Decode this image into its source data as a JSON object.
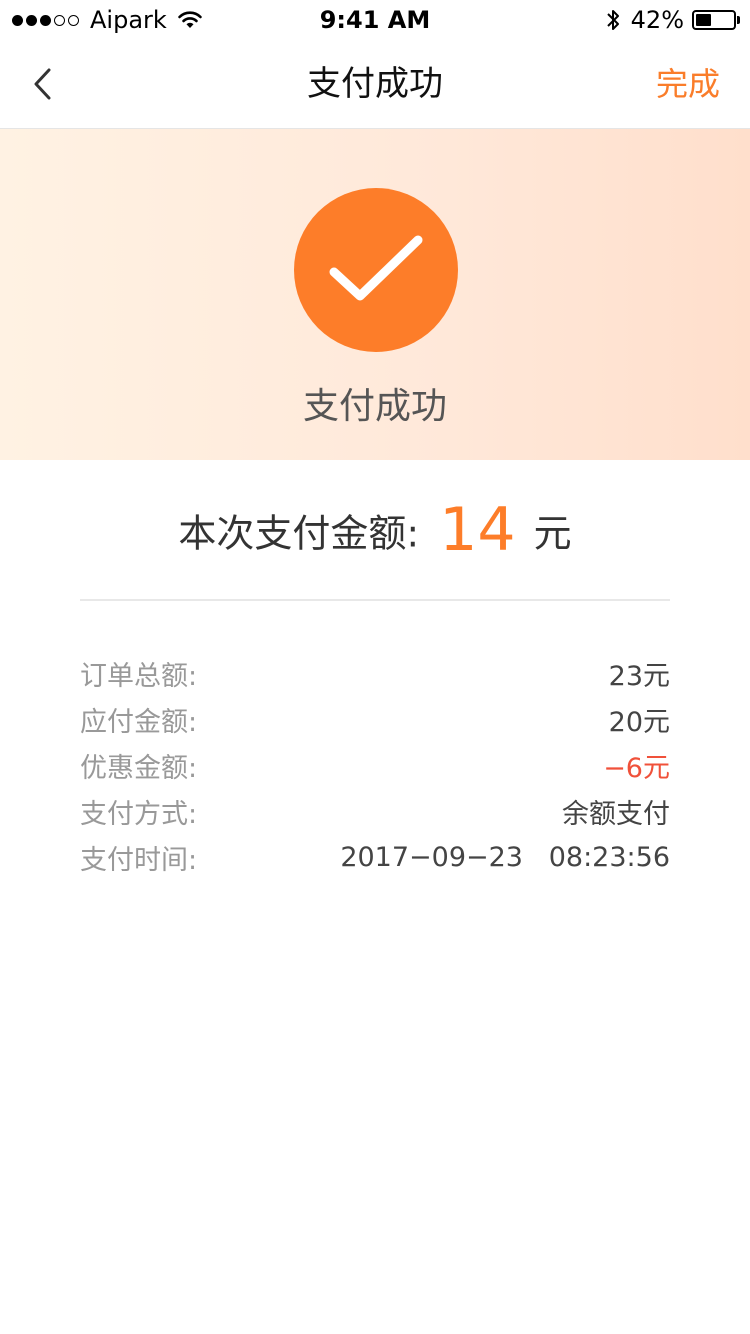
{
  "status_bar": {
    "carrier": "Aipark",
    "time": "9:41 AM",
    "battery": "42%",
    "battery_level": 0.42,
    "signal_bars_filled": 3,
    "signal_bars_total": 5
  },
  "nav": {
    "title": "支付成功",
    "done_label": "完成"
  },
  "hero": {
    "status_text": "支付成功",
    "accent_color": "#fd7d29"
  },
  "amount": {
    "label": "本次支付金额:",
    "value": "14",
    "unit": "元"
  },
  "details": [
    {
      "label": "订单总额:",
      "value": "23元"
    },
    {
      "label": "应付金额:",
      "value": "20元"
    },
    {
      "label": "优惠金额:",
      "value": "−6元"
    },
    {
      "label": "支付方式:",
      "value": "余额支付"
    },
    {
      "label": "支付时间:",
      "value": "2017−09−23   08:23:56"
    }
  ],
  "colors": {
    "accent": "#fd7d29",
    "discount": "#f0513a"
  }
}
